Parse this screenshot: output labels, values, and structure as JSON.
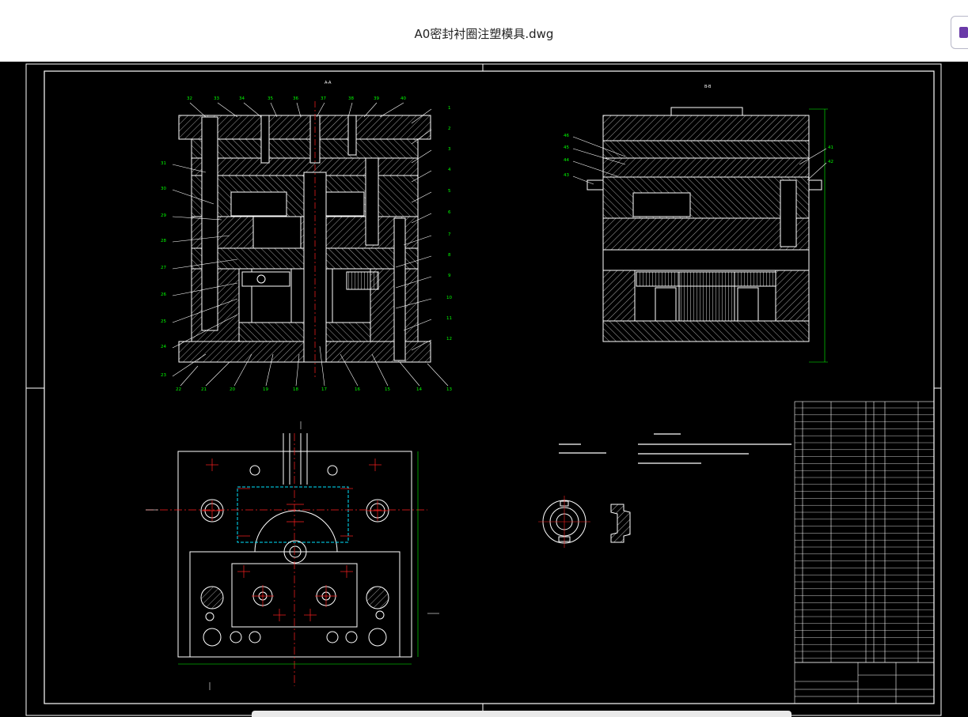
{
  "window": {
    "title": "A0密封衬圈注塑模具.dwg"
  },
  "drawing": {
    "colors": {
      "background": "#000000",
      "outline": "#ffffff",
      "callouts": "#00ff00",
      "centerlines": "#ff2020",
      "accent_cyan": "#00e5ff"
    },
    "icons": {
      "corner_button": "document-icon"
    }
  }
}
